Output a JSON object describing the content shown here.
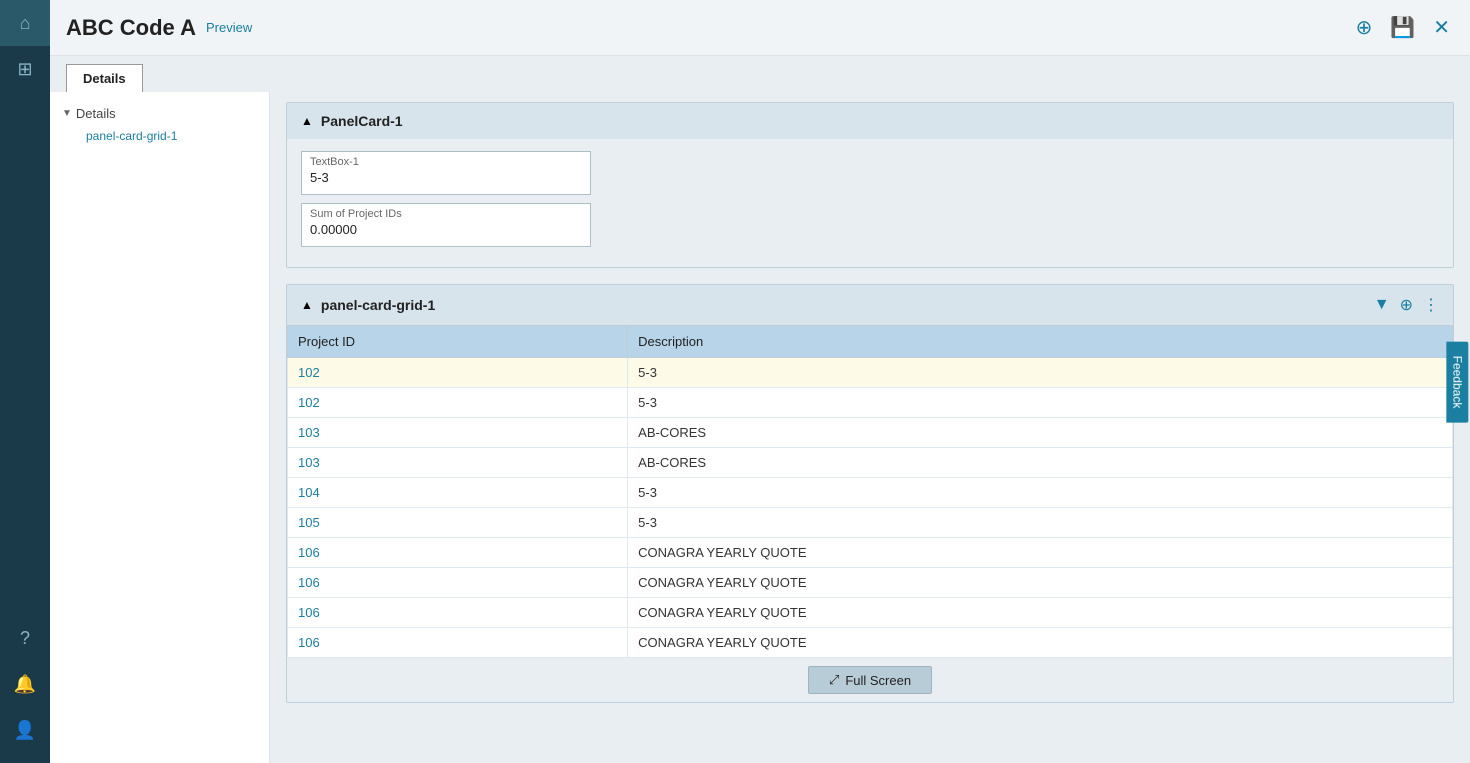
{
  "header": {
    "title": "ABC Code A",
    "preview_badge": "Preview",
    "add_icon": "⊕",
    "save_icon": "💾",
    "close_icon": "✕"
  },
  "tabs": [
    {
      "label": "Details"
    }
  ],
  "sidebar_nav": {
    "details_label": "Details",
    "panel_card_grid_item": "panel-card-grid-1"
  },
  "panel_card_1": {
    "title": "PanelCard-1",
    "textbox_label": "TextBox-1",
    "textbox_value": "5-3",
    "sum_label": "Sum of Project IDs",
    "sum_value": "0.00000"
  },
  "panel_card_grid": {
    "title": "panel-card-grid-1",
    "col_project_id": "Project ID",
    "col_description": "Description",
    "rows": [
      {
        "project_id": "102",
        "description": "5-3",
        "highlighted": true
      },
      {
        "project_id": "102",
        "description": "5-3",
        "highlighted": false
      },
      {
        "project_id": "103",
        "description": "AB-CORES",
        "highlighted": false
      },
      {
        "project_id": "103",
        "description": "AB-CORES",
        "highlighted": false
      },
      {
        "project_id": "104",
        "description": "5-3",
        "highlighted": false
      },
      {
        "project_id": "105",
        "description": "5-3",
        "highlighted": false
      },
      {
        "project_id": "106",
        "description": "CONAGRA YEARLY QUOTE",
        "highlighted": false
      },
      {
        "project_id": "106",
        "description": "CONAGRA YEARLY QUOTE",
        "highlighted": false
      },
      {
        "project_id": "106",
        "description": "CONAGRA YEARLY QUOTE",
        "highlighted": false
      },
      {
        "project_id": "106",
        "description": "CONAGRA YEARLY QUOTE",
        "highlighted": false
      }
    ]
  },
  "fullscreen_btn": "Full Screen",
  "feedback_label": "Feedback"
}
